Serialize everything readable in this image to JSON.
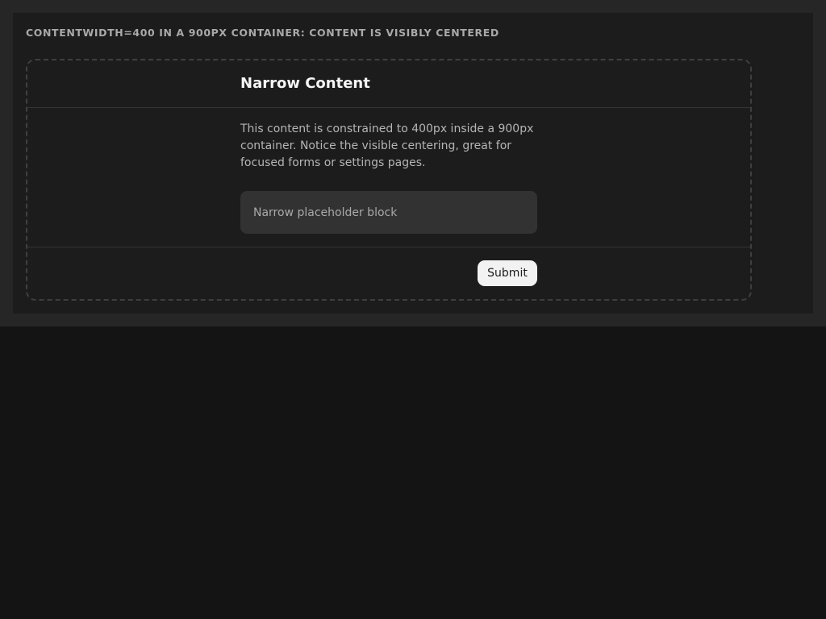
{
  "demo": {
    "caption": "CONTENTWIDTH=400 IN A 900PX CONTAINER: CONTENT IS VISIBLY CENTERED"
  },
  "card": {
    "title": "Narrow Content",
    "description": "This content is constrained to 400px inside a 900px container. Notice the visible centering, great for focused forms or settings pages.",
    "placeholder_text": "Narrow placeholder block",
    "submit_label": "Submit"
  },
  "colors": {
    "page_background": "#141414",
    "outer_band": "#262626",
    "panel_background": "#1c1c1c",
    "dashed_border": "#3f3f3f",
    "placeholder_background": "#323232",
    "button_background": "#f2f2f2"
  }
}
